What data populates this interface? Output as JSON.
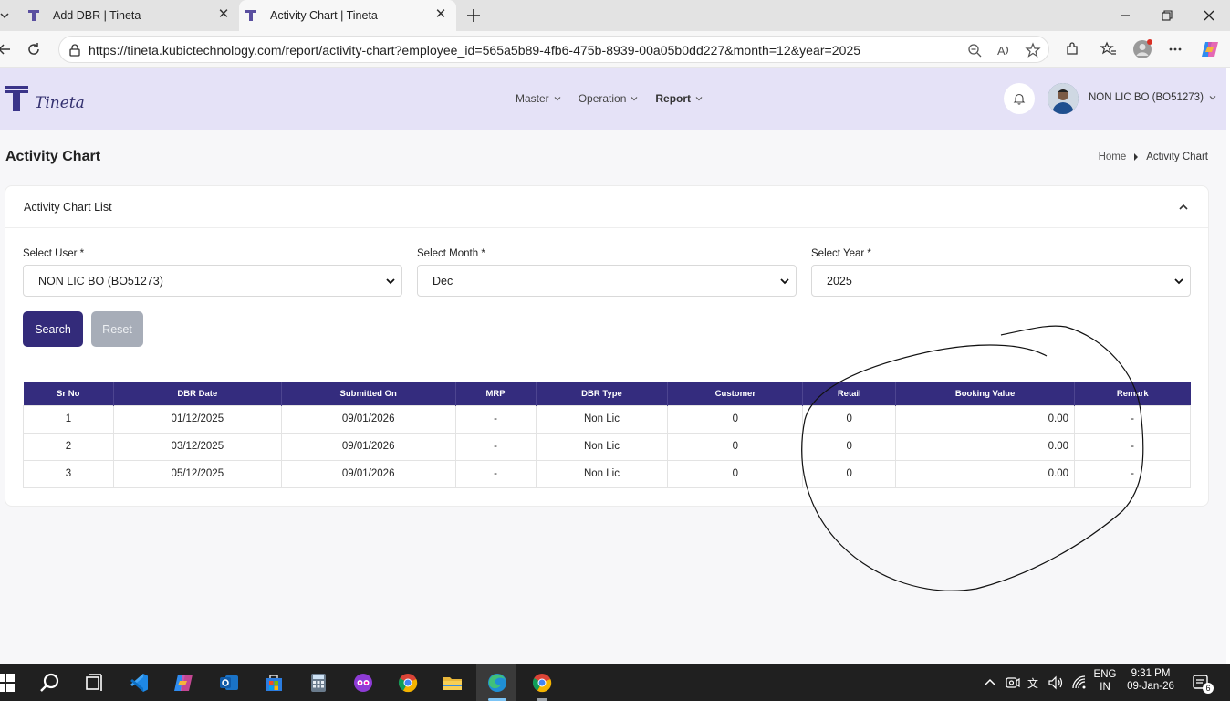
{
  "browser": {
    "tabs": [
      {
        "title": "Add DBR | Tineta",
        "active": false
      },
      {
        "title": "Activity Chart | Tineta",
        "active": true
      }
    ],
    "url": "https://tineta.kubictechnology.com/report/activity-chart?employee_id=565a5b89-4fb6-475b-8939-00a05b0dd227&month=12&year=2025"
  },
  "app": {
    "logo_text": "Tineta",
    "nav": [
      {
        "label": "Master"
      },
      {
        "label": "Operation"
      },
      {
        "label": "Report"
      }
    ],
    "user_name": "NON LIC BO (BO51273)"
  },
  "page": {
    "title": "Activity Chart",
    "breadcrumb": {
      "home": "Home",
      "current": "Activity Chart"
    }
  },
  "card": {
    "title": "Activity Chart List",
    "filters": {
      "user": {
        "label": "Select User *",
        "value": "NON LIC BO (BO51273)"
      },
      "month": {
        "label": "Select Month *",
        "value": "Dec"
      },
      "year": {
        "label": "Select Year *",
        "value": "2025"
      }
    },
    "search_label": "Search",
    "reset_label": "Reset"
  },
  "table": {
    "headers": [
      "Sr No",
      "DBR Date",
      "Submitted On",
      "MRP",
      "DBR Type",
      "Customer",
      "Retail",
      "Booking Value",
      "Remark"
    ],
    "rows": [
      [
        "1",
        "01/12/2025",
        "09/01/2026",
        "-",
        "Non Lic",
        "0",
        "0",
        "0.00",
        "-"
      ],
      [
        "2",
        "03/12/2025",
        "09/01/2026",
        "-",
        "Non Lic",
        "0",
        "0",
        "0.00",
        "-"
      ],
      [
        "3",
        "05/12/2025",
        "09/01/2026",
        "-",
        "Non Lic",
        "0",
        "0",
        "0.00",
        "-"
      ]
    ]
  },
  "taskbar": {
    "lang_line1": "ENG",
    "lang_line2": "IN",
    "time": "9:31 PM",
    "date": "09-Jan-26",
    "notification_count": "6"
  },
  "colors": {
    "brand": "#342c7e",
    "header_bg": "#e5e2f7",
    "reset_button": "#a7adb8"
  }
}
